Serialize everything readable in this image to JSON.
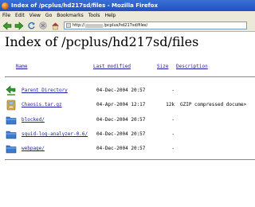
{
  "window": {
    "title": "Index of /pcplus/hd217sd/files - Mozilla Firefox"
  },
  "menu": [
    "File",
    "Edit",
    "View",
    "Go",
    "Bookmarks",
    "Tools",
    "Help"
  ],
  "address": {
    "prefix": "http://",
    "suffix": "/pcplus/hd217sd/files/"
  },
  "page": {
    "heading": "Index of /pcplus/hd217sd/files",
    "columns": {
      "name": "Name",
      "modified": "Last modified",
      "size": "Size",
      "description": "Description"
    },
    "rows": [
      {
        "name": "Parent Directory",
        "date": "04-Dec-2004 20:57",
        "size": "-",
        "desc": "",
        "icon": "parent-directory-icon"
      },
      {
        "name": "Chaosis.tar.gz",
        "date": "04-Apr-2004 12:17",
        "size": "12k",
        "desc": "GZIP compressed docume>",
        "icon": "archive-file-icon"
      },
      {
        "name": "blocked/",
        "date": "04-Dec-2004 20:57",
        "size": "-",
        "desc": "",
        "icon": "folder-icon"
      },
      {
        "name": "squid-log-analyzer-0.6/",
        "date": "04-Dec-2004 20:57",
        "size": "-",
        "desc": "",
        "icon": "folder-icon"
      },
      {
        "name": "webpage/",
        "date": "04-Dec-2004 20:57",
        "size": "-",
        "desc": "",
        "icon": "folder-icon"
      }
    ]
  }
}
